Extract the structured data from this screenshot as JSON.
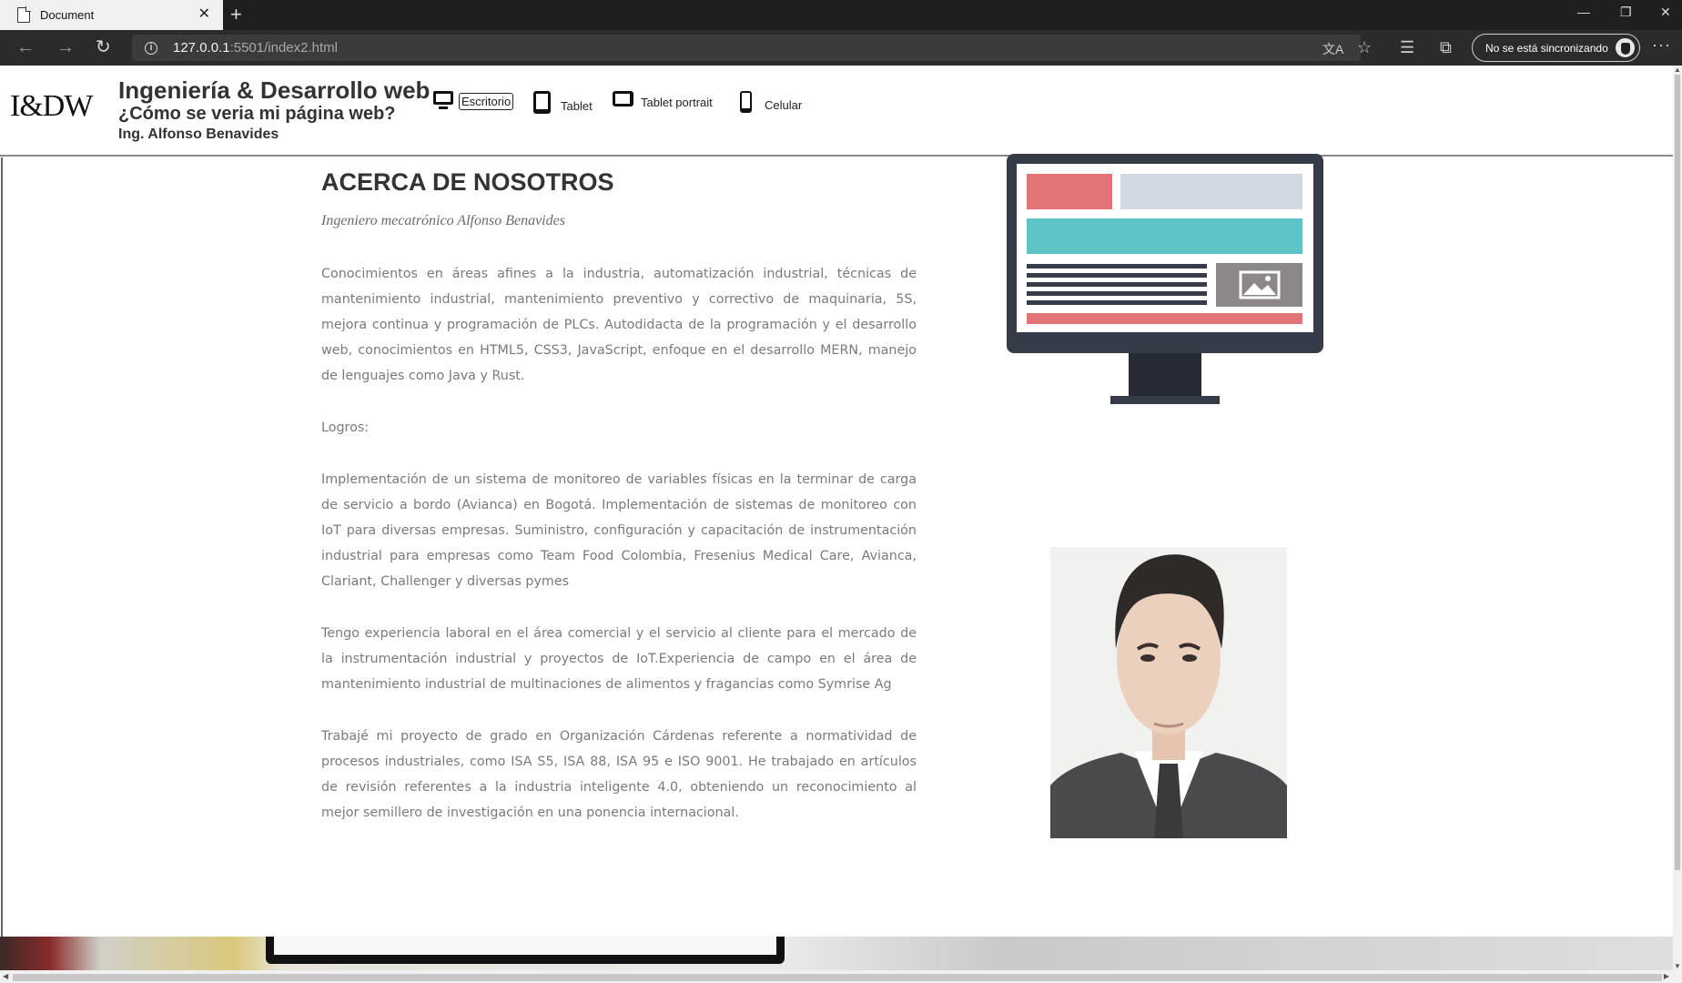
{
  "browser": {
    "tab_title": "Document",
    "tab_close": "✕",
    "new_tab": "+",
    "url_host": "127.0.0.1",
    "url_rest": ":5501/index2.html",
    "sync_label": "No se está sincronizando",
    "more": "···",
    "window_controls": {
      "minimize": "—",
      "restore": "❐",
      "close": "✕"
    }
  },
  "header": {
    "logo": "I&DW",
    "title": "Ingeniería & Desarrollo web",
    "subtitle": "¿Cómo se veria mi página web?",
    "author": "Ing. Alfonso Benavides"
  },
  "devices": [
    {
      "label": "Escritorio",
      "icon": "desktop-icon",
      "active": true
    },
    {
      "label": "Tablet",
      "icon": "tablet-icon",
      "active": false
    },
    {
      "label": "Tablet portrait",
      "icon": "tablet-landscape-icon",
      "active": false
    },
    {
      "label": "Celular",
      "icon": "phone-icon",
      "active": false
    }
  ],
  "about": {
    "title": "ACERCA DE NOSOTROS",
    "subtitle": "Ingeniero mecatrónico Alfonso Benavides",
    "paragraphs": {
      "p1": "Conocimientos en áreas afines a la industria, automatización industrial, técnicas de mantenimiento industrial, mantenimiento preventivo y correctivo de maquinaria, 5S, mejora continua y programación de PLCs. Autodidacta de la programación y el desarrollo web, conocimientos en HTML5, CSS3, JavaScript, enfoque en el desarrollo MERN, manejo de lenguajes como Java y Rust.",
      "logros": "Logros:",
      "p2": "Implementación de un sistema de monitoreo de variables físicas en la terminar de carga de servicio a bordo (Avianca) en Bogotá. Implementación de sistemas de monitoreo con IoT para diversas empresas. Suministro, configuración y capacitación de instrumentación industrial para empresas como Team Food Colombia, Fresenius Medical Care, Avianca, Clariant, Challenger y diversas pymes",
      "p3": "Tengo experiencia laboral en el área comercial y el servicio al cliente para el mercado de la instrumentación industrial y proyectos de IoT.Experiencia de campo en el área de mantenimiento industrial de multinaciones de alimentos y fragancias como Symrise Ag",
      "p4": "Trabajé mi proyecto de grado en Organización Cárdenas referente a normatividad de procesos industriales, como ISA S5, ISA 88, ISA 95 e ISO 9001. He trabajado en artículos de revisión referentes a la industria inteligente 4.0, obteniendo un reconocimiento al mejor semillero de investigación en una ponencia internacional."
    }
  },
  "colors": {
    "monitor_frame": "#363b48",
    "monitor_red": "#e27377",
    "monitor_gray": "#d2d8e2",
    "monitor_teal": "#5ec4c8",
    "monitor_img": "#8c8789"
  }
}
